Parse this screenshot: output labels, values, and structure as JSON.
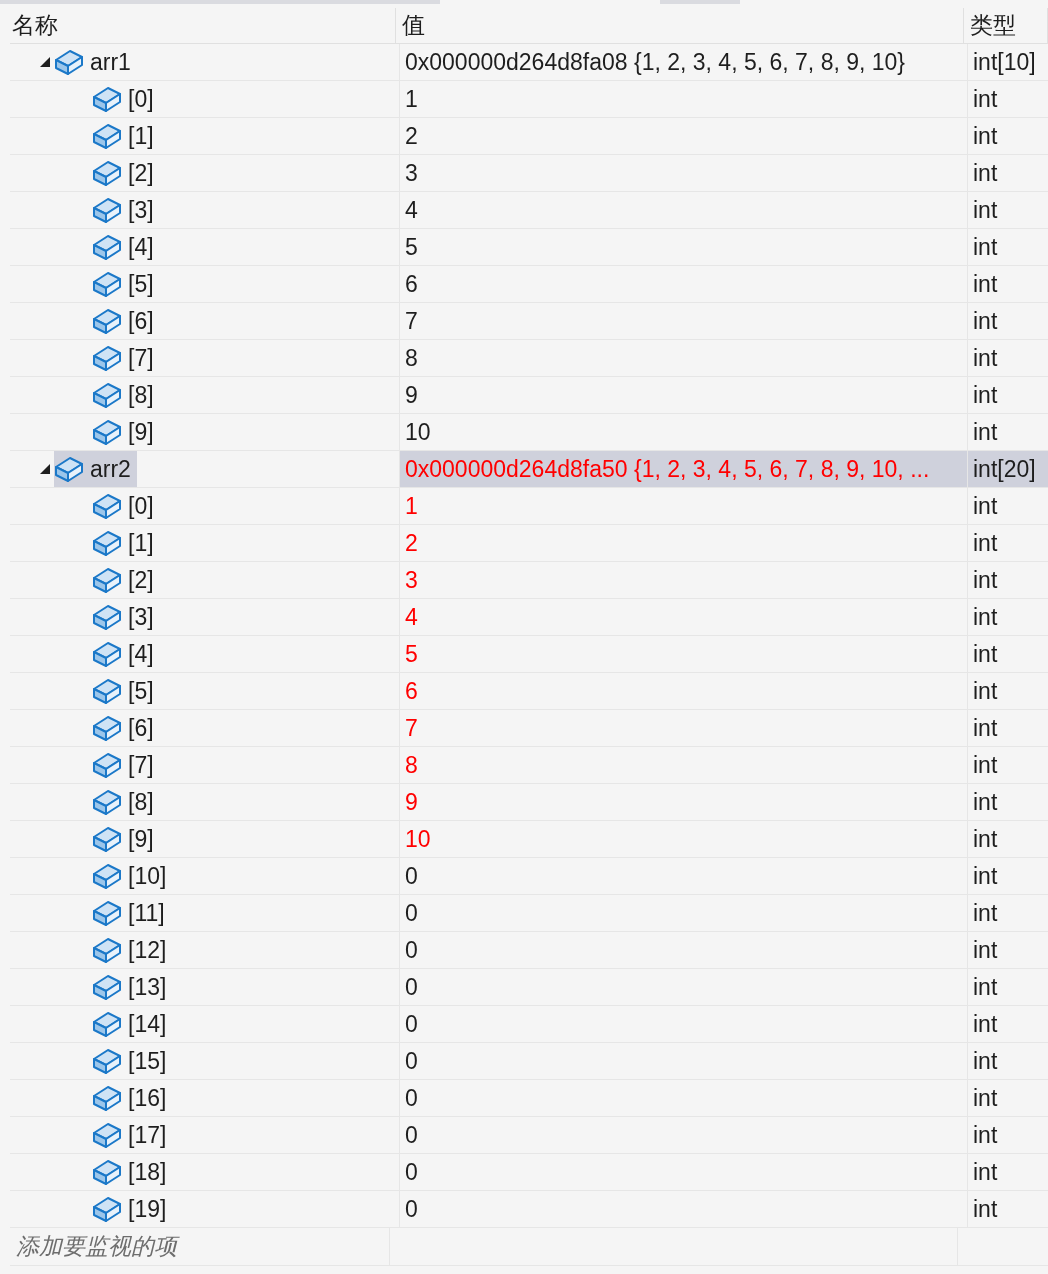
{
  "columns": [
    "名称",
    "值",
    "类型"
  ],
  "variables": [
    {
      "name": "arr1",
      "value": "0x000000d264d8fa08 {1, 2, 3, 4, 5, 6, 7, 8, 9, 10}",
      "type": "int[10]",
      "expanded": true,
      "selected": false,
      "changed": false,
      "children": [
        {
          "name": "[0]",
          "value": "1",
          "type": "int",
          "selected": false,
          "changed": false
        },
        {
          "name": "[1]",
          "value": "2",
          "type": "int",
          "selected": false,
          "changed": false
        },
        {
          "name": "[2]",
          "value": "3",
          "type": "int",
          "selected": false,
          "changed": false
        },
        {
          "name": "[3]",
          "value": "4",
          "type": "int",
          "selected": false,
          "changed": false
        },
        {
          "name": "[4]",
          "value": "5",
          "type": "int",
          "selected": false,
          "changed": false
        },
        {
          "name": "[5]",
          "value": "6",
          "type": "int",
          "selected": false,
          "changed": false
        },
        {
          "name": "[6]",
          "value": "7",
          "type": "int",
          "selected": false,
          "changed": false
        },
        {
          "name": "[7]",
          "value": "8",
          "type": "int",
          "selected": false,
          "changed": false
        },
        {
          "name": "[8]",
          "value": "9",
          "type": "int",
          "selected": false,
          "changed": false
        },
        {
          "name": "[9]",
          "value": "10",
          "type": "int",
          "selected": false,
          "changed": false
        }
      ]
    },
    {
      "name": "arr2",
      "value": "0x000000d264d8fa50 {1, 2, 3, 4, 5, 6, 7, 8, 9, 10, ...",
      "type": "int[20]",
      "expanded": true,
      "selected": true,
      "changed": true,
      "children": [
        {
          "name": "[0]",
          "value": "1",
          "type": "int",
          "selected": false,
          "changed": true
        },
        {
          "name": "[1]",
          "value": "2",
          "type": "int",
          "selected": false,
          "changed": true
        },
        {
          "name": "[2]",
          "value": "3",
          "type": "int",
          "selected": false,
          "changed": true
        },
        {
          "name": "[3]",
          "value": "4",
          "type": "int",
          "selected": false,
          "changed": true
        },
        {
          "name": "[4]",
          "value": "5",
          "type": "int",
          "selected": false,
          "changed": true
        },
        {
          "name": "[5]",
          "value": "6",
          "type": "int",
          "selected": false,
          "changed": true
        },
        {
          "name": "[6]",
          "value": "7",
          "type": "int",
          "selected": false,
          "changed": true
        },
        {
          "name": "[7]",
          "value": "8",
          "type": "int",
          "selected": false,
          "changed": true
        },
        {
          "name": "[8]",
          "value": "9",
          "type": "int",
          "selected": false,
          "changed": true
        },
        {
          "name": "[9]",
          "value": "10",
          "type": "int",
          "selected": false,
          "changed": true
        },
        {
          "name": "[10]",
          "value": "0",
          "type": "int",
          "selected": false,
          "changed": false
        },
        {
          "name": "[11]",
          "value": "0",
          "type": "int",
          "selected": false,
          "changed": false
        },
        {
          "name": "[12]",
          "value": "0",
          "type": "int",
          "selected": false,
          "changed": false
        },
        {
          "name": "[13]",
          "value": "0",
          "type": "int",
          "selected": false,
          "changed": false
        },
        {
          "name": "[14]",
          "value": "0",
          "type": "int",
          "selected": false,
          "changed": false
        },
        {
          "name": "[15]",
          "value": "0",
          "type": "int",
          "selected": false,
          "changed": false
        },
        {
          "name": "[16]",
          "value": "0",
          "type": "int",
          "selected": false,
          "changed": false
        },
        {
          "name": "[17]",
          "value": "0",
          "type": "int",
          "selected": false,
          "changed": false
        },
        {
          "name": "[18]",
          "value": "0",
          "type": "int",
          "selected": false,
          "changed": false
        },
        {
          "name": "[19]",
          "value": "0",
          "type": "int",
          "selected": false,
          "changed": false
        }
      ]
    }
  ],
  "add_item": {
    "placeholder": "添加要监视的项"
  }
}
